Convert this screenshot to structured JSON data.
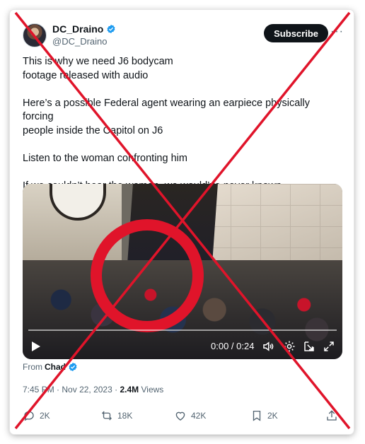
{
  "author": {
    "display_name": "DC_Draino",
    "handle": "@DC_Draino"
  },
  "subscribe_label": "Subscribe",
  "more_label": "···",
  "tweet": {
    "lines": [
      "This is why we need J6 bodycam",
      "footage released with audio",
      "",
      "Here’s a possible Federal agent wearing an earpiece physically forcing",
      "people inside the Capitol on J6",
      "",
      "Listen to the woman confronting him",
      "",
      "If we couldn’t hear the woman, we would’ve never known"
    ]
  },
  "video": {
    "time_display": "0:00 / 0:24",
    "progress_fraction": 0.0
  },
  "from": {
    "prefix": "From",
    "source": "Chad"
  },
  "meta": {
    "time": "7:45 PM",
    "separator": "·",
    "date": "Nov 22, 2023",
    "views_count": "2.4M",
    "views_label": "Views"
  },
  "actions": {
    "replies": "2K",
    "reposts": "18K",
    "likes": "42K",
    "bookmarks": "2K"
  },
  "colors": {
    "verified_blue": "#1d9bf0",
    "overlay_red": "#e0142a",
    "text_secondary": "#536471"
  },
  "icons": {
    "verified": "verified-badge-icon",
    "play": "play-icon",
    "volume": "volume-icon",
    "settings": "settings-gear-icon",
    "minimize": "minimize-icon",
    "fullscreen": "fullscreen-icon",
    "reply": "reply-icon",
    "repost": "repost-icon",
    "like": "heart-icon",
    "bookmark": "bookmark-icon",
    "share": "share-icon"
  }
}
